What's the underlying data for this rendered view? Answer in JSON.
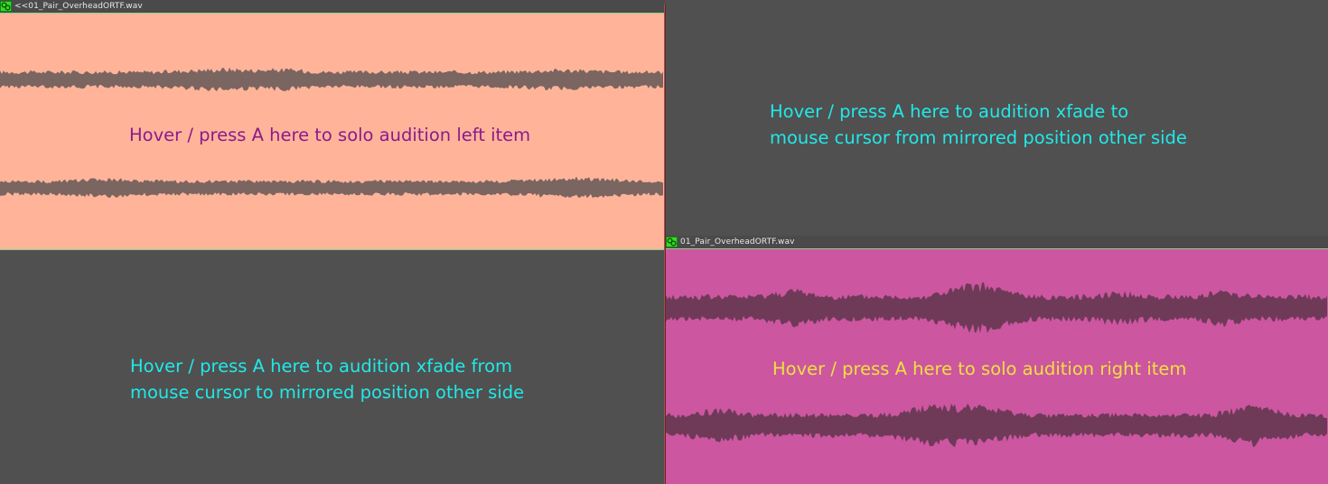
{
  "left_item": {
    "name": "<<01_Pair_OverheadORTF.wav",
    "body_color": "#ffb49a",
    "waveform_color": "#7a6560",
    "hint": "Hover / press A here to solo audition left item",
    "hint_color": "#8b1a8b",
    "icon": "item-take-icon"
  },
  "right_item": {
    "name": "01_Pair_OverheadORTF.wav",
    "body_color": "#cc56a0",
    "waveform_color": "#6e3a58",
    "hint": "Hover / press A here to solo audition right item",
    "hint_color": "#f0e040",
    "icon": "item-take-icon"
  },
  "xfade_to_hint": {
    "line1": "Hover / press A here to audition xfade to",
    "line2": "mouse cursor from mirrored position other side",
    "color": "#22e8e8"
  },
  "xfade_from_hint": {
    "line1": "Hover / press A here to audition xfade from",
    "line2": "mouse cursor to mirrored position other side",
    "color": "#22e8e8"
  },
  "colors": {
    "background": "#505050",
    "header_bar": "#4a4a4a",
    "item_edge": "#8ccf8c",
    "crossfade_edge": "#c84040"
  }
}
